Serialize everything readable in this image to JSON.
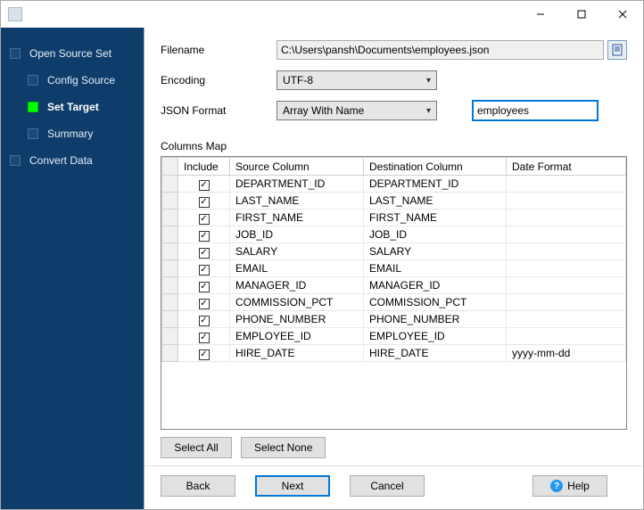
{
  "titlebar": {
    "title": ""
  },
  "nav": {
    "items": [
      {
        "label": "Open Source Set",
        "sub": false,
        "active": false
      },
      {
        "label": "Config Source",
        "sub": true,
        "active": false
      },
      {
        "label": "Set Target",
        "sub": true,
        "active": true
      },
      {
        "label": "Summary",
        "sub": true,
        "active": false
      },
      {
        "label": "Convert Data",
        "sub": false,
        "active": false
      }
    ]
  },
  "form": {
    "filename_label": "Filename",
    "filename_value": "C:\\Users\\pansh\\Documents\\employees.json",
    "encoding_label": "Encoding",
    "encoding_value": "UTF-8",
    "format_label": "JSON Format",
    "format_value": "Array With Name",
    "array_name_value": "employees"
  },
  "columns_label": "Columns Map",
  "grid": {
    "headers": {
      "include": "Include",
      "source": "Source Column",
      "dest": "Destination Column",
      "date": "Date Format"
    },
    "rows": [
      {
        "include": true,
        "source": "DEPARTMENT_ID",
        "dest": "DEPARTMENT_ID",
        "date": ""
      },
      {
        "include": true,
        "source": "LAST_NAME",
        "dest": "LAST_NAME",
        "date": ""
      },
      {
        "include": true,
        "source": "FIRST_NAME",
        "dest": "FIRST_NAME",
        "date": ""
      },
      {
        "include": true,
        "source": "JOB_ID",
        "dest": "JOB_ID",
        "date": ""
      },
      {
        "include": true,
        "source": "SALARY",
        "dest": "SALARY",
        "date": ""
      },
      {
        "include": true,
        "source": "EMAIL",
        "dest": "EMAIL",
        "date": ""
      },
      {
        "include": true,
        "source": "MANAGER_ID",
        "dest": "MANAGER_ID",
        "date": ""
      },
      {
        "include": true,
        "source": "COMMISSION_PCT",
        "dest": "COMMISSION_PCT",
        "date": ""
      },
      {
        "include": true,
        "source": "PHONE_NUMBER",
        "dest": "PHONE_NUMBER",
        "date": ""
      },
      {
        "include": true,
        "source": "EMPLOYEE_ID",
        "dest": "EMPLOYEE_ID",
        "date": ""
      },
      {
        "include": true,
        "source": "HIRE_DATE",
        "dest": "HIRE_DATE",
        "date": "yyyy-mm-dd"
      }
    ]
  },
  "buttons": {
    "select_all": "Select All",
    "select_none": "Select None",
    "back": "Back",
    "next": "Next",
    "cancel": "Cancel",
    "help": "Help"
  }
}
